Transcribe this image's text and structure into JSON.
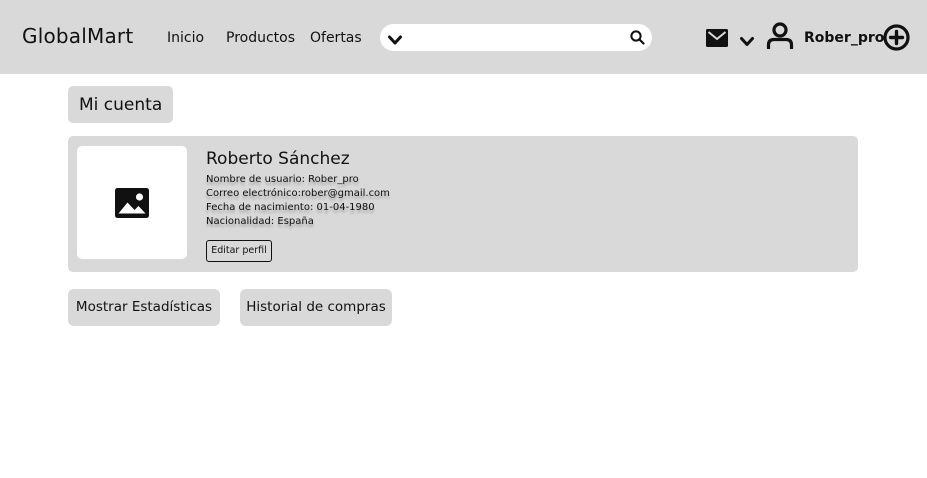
{
  "header": {
    "brand": "GlobalMart",
    "nav": [
      "Inicio",
      "Productos",
      "Ofertas"
    ],
    "search_placeholder": "",
    "username": "Rober_pro",
    "icons": [
      "chevron-down-icon",
      "search-icon",
      "mail-icon",
      "user-icon",
      "add-circle-icon"
    ]
  },
  "page": {
    "title": "Mi cuenta"
  },
  "profile": {
    "name": "Roberto Sánchez",
    "username_line": "Nombre de usuario: Rober_pro",
    "email_line": "Correo electrónico:rober@gmail.com",
    "birth_line": "Fecha de nacimiento: 01-04-1980",
    "nationality_line": "Nacionalidad: España",
    "edit_label": "Editar perfil"
  },
  "actions": {
    "stats_label": "Mostrar Estadísticas",
    "history_label": "Historial de compras"
  },
  "colors": {
    "header_bg": "#d9d9d9",
    "panel_bg": "#d9d9d9",
    "text": "#111111"
  }
}
